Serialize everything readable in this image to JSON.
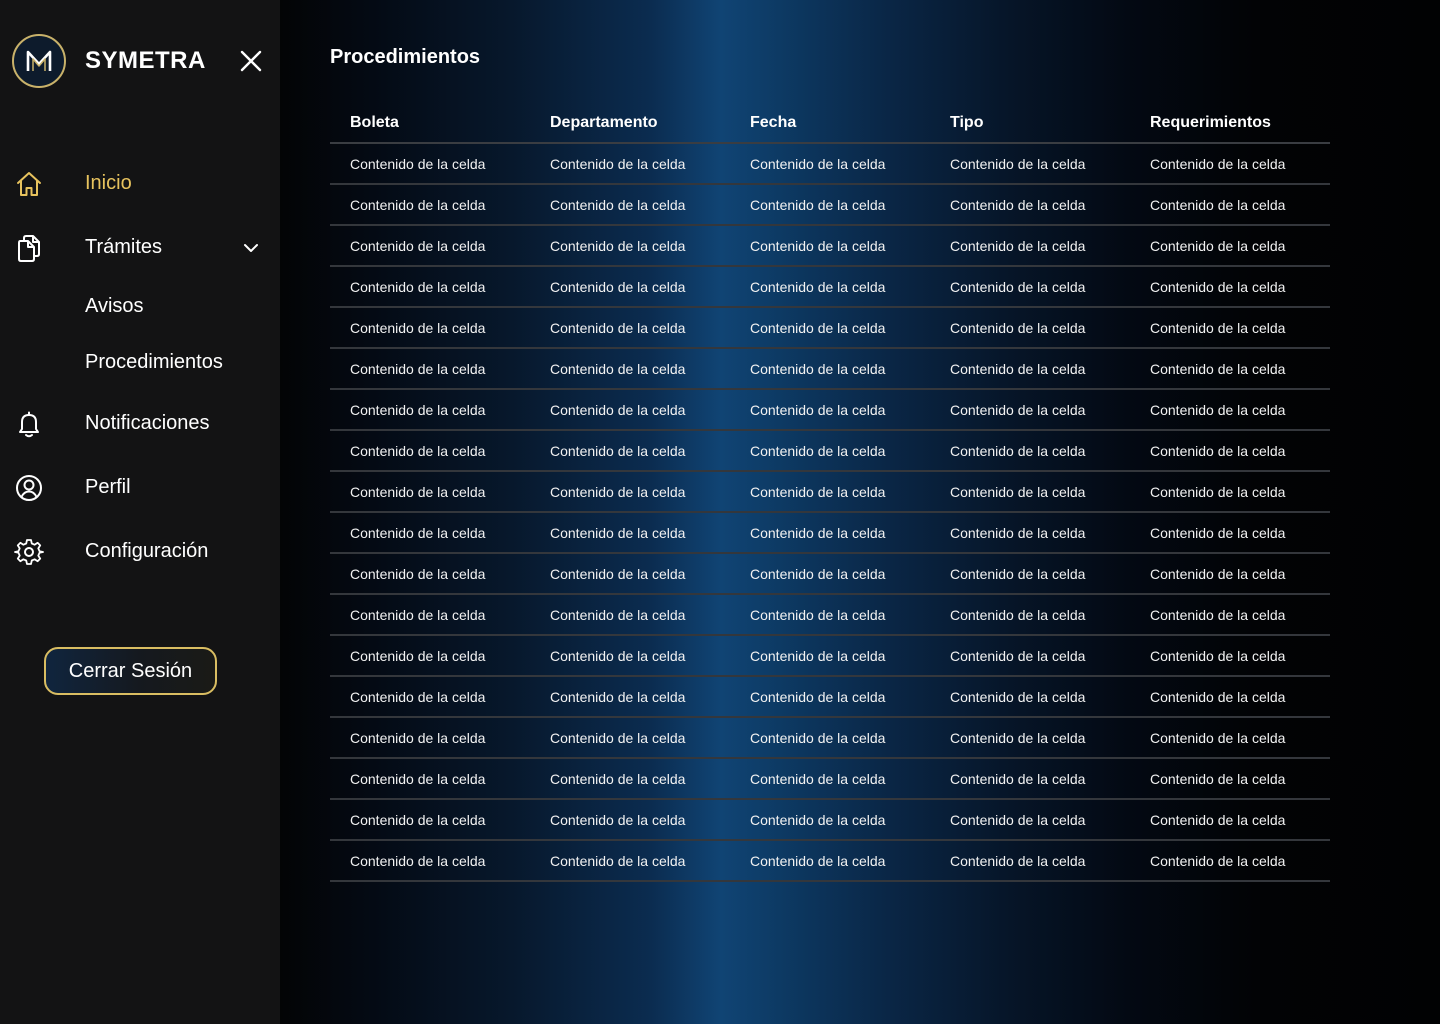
{
  "brand": {
    "name": "SYMETRA"
  },
  "sidebar": {
    "items": [
      {
        "label": "Inicio",
        "icon": "home-icon",
        "active": true
      },
      {
        "label": "Trámites",
        "icon": "documents-icon",
        "expandable": true
      },
      {
        "label": "Notificaciones",
        "icon": "bell-icon"
      },
      {
        "label": "Perfil",
        "icon": "user-circle-icon"
      },
      {
        "label": "Configuración",
        "icon": "gear-icon"
      }
    ],
    "sub_items": [
      {
        "label": "Avisos"
      },
      {
        "label": "Procedimientos"
      }
    ],
    "logout_label": "Cerrar Sesión"
  },
  "main": {
    "title": "Procedimientos",
    "table": {
      "columns": [
        "Boleta",
        "Departamento",
        "Fecha",
        "Tipo",
        "Requerimientos"
      ],
      "rows": [
        [
          "Contenido de la celda",
          "Contenido de la celda",
          "Contenido de la celda",
          "Contenido de la celda",
          "Contenido de la celda"
        ],
        [
          "Contenido de la celda",
          "Contenido de la celda",
          "Contenido de la celda",
          "Contenido de la celda",
          "Contenido de la celda"
        ],
        [
          "Contenido de la celda",
          "Contenido de la celda",
          "Contenido de la celda",
          "Contenido de la celda",
          "Contenido de la celda"
        ],
        [
          "Contenido de la celda",
          "Contenido de la celda",
          "Contenido de la celda",
          "Contenido de la celda",
          "Contenido de la celda"
        ],
        [
          "Contenido de la celda",
          "Contenido de la celda",
          "Contenido de la celda",
          "Contenido de la celda",
          "Contenido de la celda"
        ],
        [
          "Contenido de la celda",
          "Contenido de la celda",
          "Contenido de la celda",
          "Contenido de la celda",
          "Contenido de la celda"
        ],
        [
          "Contenido de la celda",
          "Contenido de la celda",
          "Contenido de la celda",
          "Contenido de la celda",
          "Contenido de la celda"
        ],
        [
          "Contenido de la celda",
          "Contenido de la celda",
          "Contenido de la celda",
          "Contenido de la celda",
          "Contenido de la celda"
        ],
        [
          "Contenido de la celda",
          "Contenido de la celda",
          "Contenido de la celda",
          "Contenido de la celda",
          "Contenido de la celda"
        ],
        [
          "Contenido de la celda",
          "Contenido de la celda",
          "Contenido de la celda",
          "Contenido de la celda",
          "Contenido de la celda"
        ],
        [
          "Contenido de la celda",
          "Contenido de la celda",
          "Contenido de la celda",
          "Contenido de la celda",
          "Contenido de la celda"
        ],
        [
          "Contenido de la celda",
          "Contenido de la celda",
          "Contenido de la celda",
          "Contenido de la celda",
          "Contenido de la celda"
        ],
        [
          "Contenido de la celda",
          "Contenido de la celda",
          "Contenido de la celda",
          "Contenido de la celda",
          "Contenido de la celda"
        ],
        [
          "Contenido de la celda",
          "Contenido de la celda",
          "Contenido de la celda",
          "Contenido de la celda",
          "Contenido de la celda"
        ],
        [
          "Contenido de la celda",
          "Contenido de la celda",
          "Contenido de la celda",
          "Contenido de la celda",
          "Contenido de la celda"
        ],
        [
          "Contenido de la celda",
          "Contenido de la celda",
          "Contenido de la celda",
          "Contenido de la celda",
          "Contenido de la celda"
        ],
        [
          "Contenido de la celda",
          "Contenido de la celda",
          "Contenido de la celda",
          "Contenido de la celda",
          "Contenido de la celda"
        ],
        [
          "Contenido de la celda",
          "Contenido de la celda",
          "Contenido de la celda",
          "Contenido de la celda",
          "Contenido de la celda"
        ]
      ]
    }
  },
  "colors": {
    "accent": "#e8c35e",
    "sidebar_bg": "#131314",
    "main_bg_center": "#104474"
  }
}
